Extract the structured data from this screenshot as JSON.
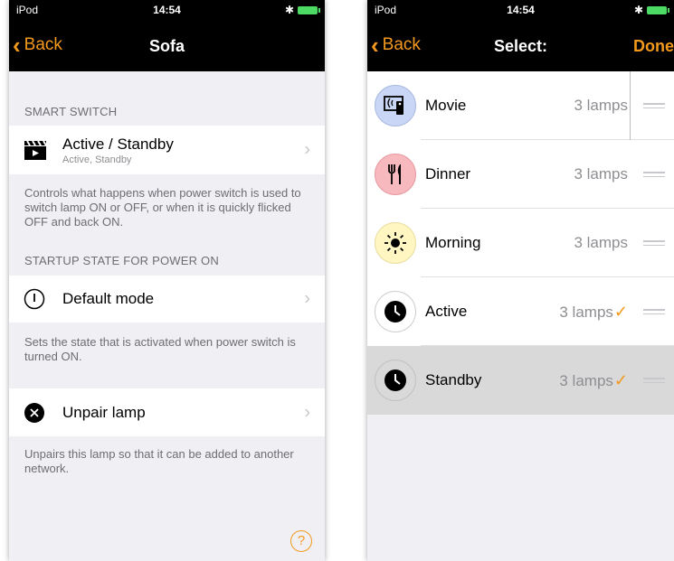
{
  "left": {
    "status": {
      "carrier": "iPod",
      "time": "14:54",
      "bluetooth": "✱"
    },
    "nav": {
      "back": "Back",
      "title": "Sofa"
    },
    "smart_switch": {
      "header": "SMART SWITCH",
      "title": "Active / Standby",
      "subtitle": "Active, Standby",
      "footer": "Controls what happens when power switch is used to switch lamp ON or OFF, or when it is quickly flicked OFF and back ON."
    },
    "startup": {
      "header": "STARTUP STATE FOR POWER ON",
      "title": "Default mode",
      "footer": "Sets the state that is activated when power switch is turned ON."
    },
    "unpair": {
      "title": "Unpair lamp",
      "footer": "Unpairs this lamp so that it can be added to another network."
    },
    "help": "?"
  },
  "right": {
    "status": {
      "carrier": "iPod",
      "time": "14:54",
      "bluetooth": "✱"
    },
    "nav": {
      "back": "Back",
      "title": "Select:",
      "done": "Done"
    },
    "scenes": [
      {
        "name": "Movie",
        "count": "3 lamps",
        "checked": false,
        "icon": "tv-remote-icon",
        "bg": "#c9d6f5"
      },
      {
        "name": "Dinner",
        "count": "3 lamps",
        "checked": false,
        "icon": "fork-knife-icon",
        "bg": "#f7b9be"
      },
      {
        "name": "Morning",
        "count": "3 lamps",
        "checked": false,
        "icon": "sun-icon",
        "bg": "#fff6c2"
      },
      {
        "name": "Active",
        "count": "3 lamps",
        "checked": true,
        "icon": "clock-icon",
        "bg": "#ffffff"
      },
      {
        "name": "Standby",
        "count": "3 lamps",
        "checked": true,
        "icon": "clock-icon",
        "bg": "#d9d9d9"
      }
    ]
  },
  "colors": {
    "accent": "#f39a1e",
    "navbar": "#000000",
    "background": "#efeff4"
  }
}
